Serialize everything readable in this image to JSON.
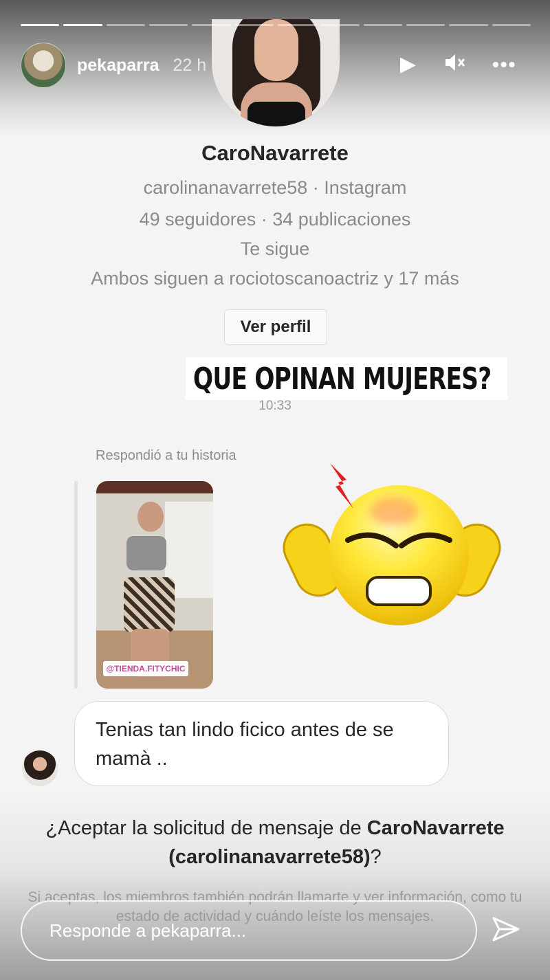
{
  "story": {
    "username": "pekaparra",
    "age": "22 h",
    "progress_segments": 12,
    "progress_done": 2
  },
  "profile": {
    "display_name": "CaroNavarrete",
    "handle_line": "carolinanavarrete58 · Instagram",
    "stats_line": "49 seguidores · 34 publicaciones",
    "follows_line": "Te sigue",
    "mutual_line": "Ambos siguen a rociotoscanoactriz y 17 más",
    "view_profile_label": "Ver perfil"
  },
  "sticker_text": "QUE OPINAN MUJERES?",
  "message_time": "10:33",
  "reply_label": "Respondió a tu historia",
  "story_thumbnail_tag": "@TIENDA.FITYCHIC",
  "message_text": "Tenias tan lindo ficico antes de se mamà ..",
  "request": {
    "question_prefix": "¿Aceptar la solicitud de mensaje de ",
    "name": "CaroNavarrete",
    "handle": "(carolinanavarrete58)",
    "question_suffix": "?",
    "disclaimer": "Si aceptas, los miembros también podrán llamarte y ver información, como tu estado de actividad y cuándo leíste los mensajes."
  },
  "reply_input": {
    "placeholder": "Responde a pekaparra..."
  },
  "icons": {
    "play": "play-icon",
    "mute": "mute-icon",
    "more": "more-icon",
    "send": "send-icon",
    "emoji": "angry-headache-emoji"
  }
}
